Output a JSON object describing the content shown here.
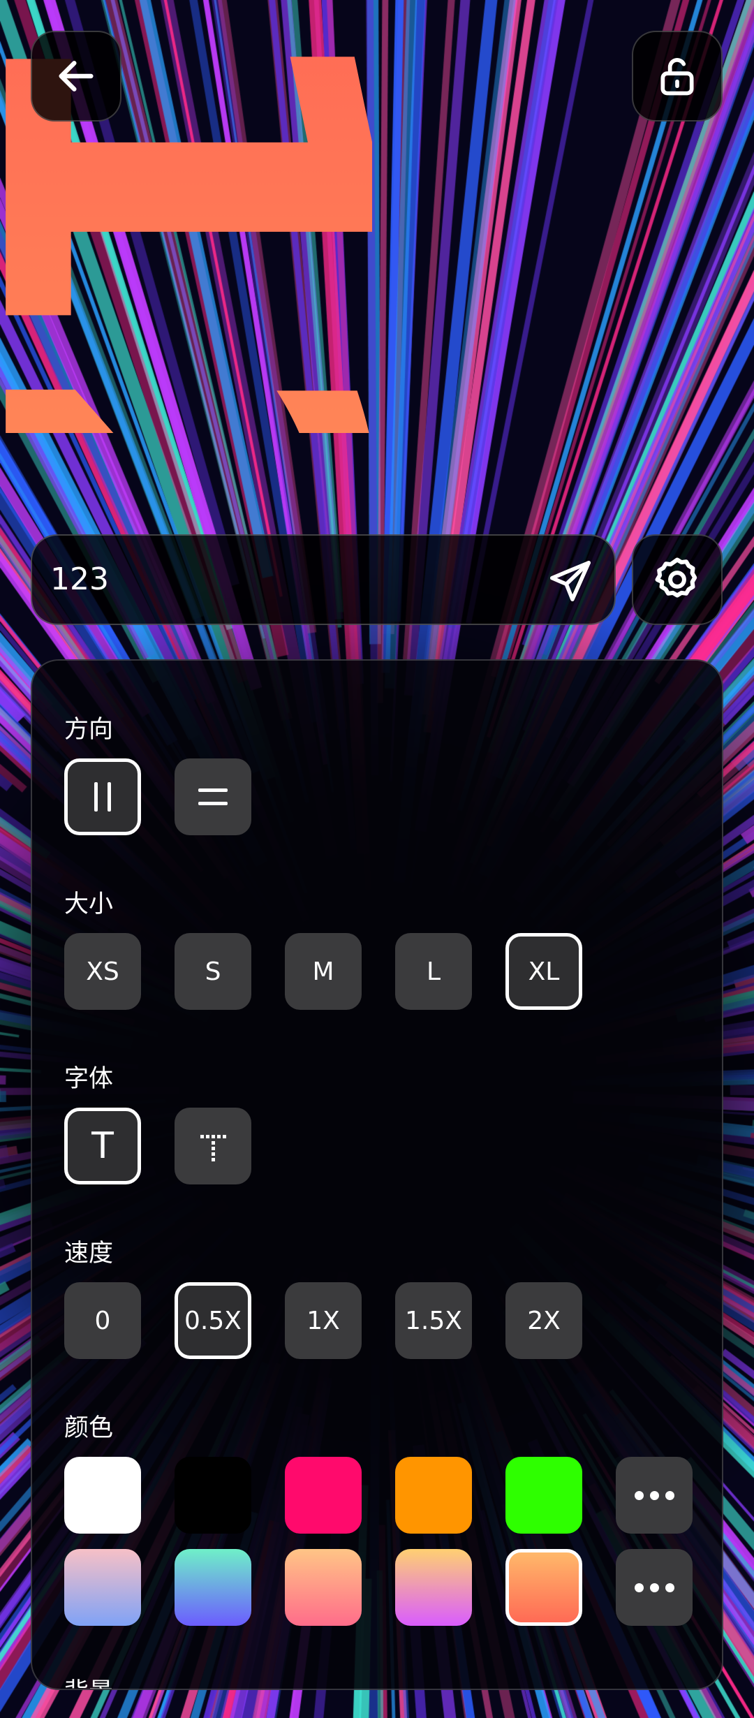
{
  "display": {
    "text": "123",
    "gradient_start": "#ff6a55",
    "gradient_end": "#ffab5a"
  },
  "input": {
    "value": "123"
  },
  "panel": {
    "direction": {
      "label": "方向",
      "selected": "vertical",
      "options": [
        {
          "name": "vertical",
          "icon": "vertical-bars-icon"
        },
        {
          "name": "horizontal",
          "icon": "horizontal-bars-icon"
        }
      ]
    },
    "size": {
      "label": "大小",
      "options": [
        "XS",
        "S",
        "M",
        "L",
        "XL"
      ],
      "selected": "XL"
    },
    "font": {
      "label": "字体",
      "selected": "regular",
      "options": [
        {
          "name": "regular",
          "glyph": "T"
        },
        {
          "name": "dotted",
          "glyph": "T"
        }
      ]
    },
    "speed": {
      "label": "速度",
      "options": [
        "0",
        "0.5X",
        "1X",
        "1.5X",
        "2X"
      ],
      "selected": "0.5X"
    },
    "color": {
      "label": "颜色",
      "solid": [
        "#ffffff",
        "#000000",
        "#ff0a6c",
        "#ff9500",
        "#2eff00"
      ],
      "gradients": [
        [
          "#f7c0c6",
          "#7fa2f6"
        ],
        [
          "#6ff0c8",
          "#6b5cff"
        ],
        [
          "#ffc586",
          "#ff6c8a"
        ],
        [
          "#ffd071",
          "#d95cff"
        ],
        [
          "#ffb86a",
          "#ff6a55"
        ]
      ],
      "selected_gradient": 4
    },
    "next_label": "背景"
  },
  "icons": {
    "back": "arrow-left-icon",
    "lock": "unlock-icon",
    "send": "paper-plane-icon",
    "settings": "gear-icon",
    "more": "more-dots-icon"
  }
}
